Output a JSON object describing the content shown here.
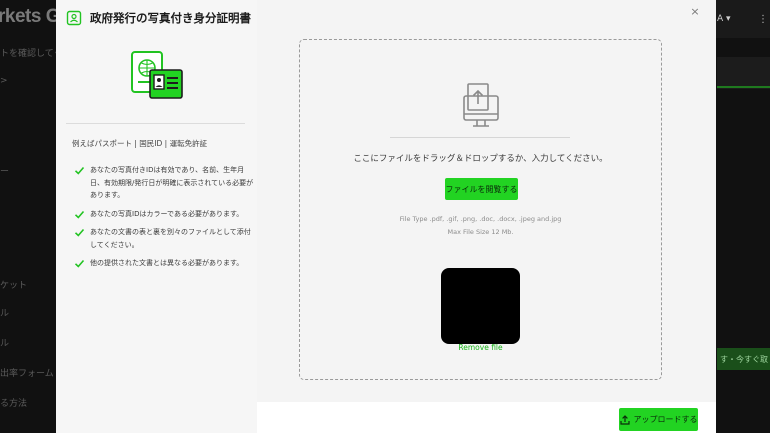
{
  "background": {
    "logo_text": "rkets Glo",
    "hint_text": "トを確認してくだ",
    "side_items": [
      ">",
      "ー",
      "ケット",
      "ル",
      "ル",
      "出率フォーム",
      "る方法"
    ],
    "user_text": "A",
    "green_strip_text": "す・今すぐ取"
  },
  "modal": {
    "title": "政府発行の写真付き身分証明書",
    "examples": "例えばパスポート | 国民ID | 運転免許証",
    "requirements": [
      "あなたの写真付きIDは有効であり、名前、生年月日、有効期限/発行日が明確に表示されている必要があります。",
      "あなたの写真IDはカラーである必要があります。",
      "あなたの文書の表と裏を別々のファイルとして添付してください。",
      "他の提供された文書とは異なる必要があります。"
    ],
    "close_label": "×",
    "dropzone": {
      "instruction": "ここにファイルをドラッグ＆ドロップするか、入力してください。",
      "browse_label": "ファイルを閲覧する",
      "file_types": "File Type .pdf, .gif, .png, .doc, .docx, .jpeg and.jpg",
      "max_size": "Max File Size 12 Mb.",
      "remove_label": "Remove file"
    },
    "upload_label": "アップロードする"
  },
  "colors": {
    "accent": "#22d322",
    "accent_dark_text": "#0b2b0b",
    "link": "#17b417"
  },
  "icons": [
    "id-card-icon",
    "passport-icon",
    "check-icon",
    "upload-file-icon",
    "close-icon",
    "upload-icon"
  ]
}
